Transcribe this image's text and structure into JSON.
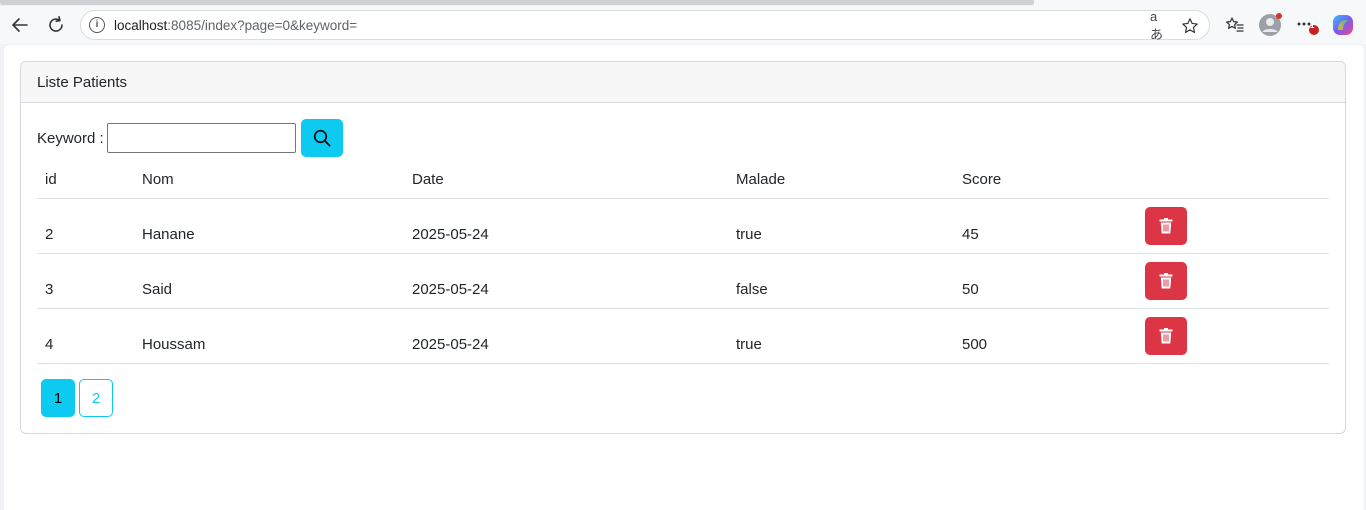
{
  "browser": {
    "url_host": "localhost",
    "url_path": ":8085/index?page=0&keyword=",
    "notification_count": "1"
  },
  "card": {
    "title": "Liste Patients"
  },
  "search": {
    "label": "Keyword :",
    "value": "",
    "placeholder": ""
  },
  "table": {
    "columns": [
      "id",
      "Nom",
      "Date",
      "Malade",
      "Score"
    ],
    "rows": [
      {
        "id": "2",
        "nom": "Hanane",
        "date": "2025-05-24",
        "malade": "true",
        "score": "45"
      },
      {
        "id": "3",
        "nom": "Said",
        "date": "2025-05-24",
        "malade": "false",
        "score": "50"
      },
      {
        "id": "4",
        "nom": "Houssam",
        "date": "2025-05-24",
        "malade": "true",
        "score": "500"
      }
    ]
  },
  "pagination": {
    "pages": [
      "1",
      "2"
    ],
    "active_page": "1"
  },
  "colors": {
    "info": "#0dcaf0",
    "danger": "#dc3545"
  },
  "icons": {
    "back": "arrow-left-icon",
    "reload": "reload-icon",
    "site_info": "info-icon",
    "translate": "translate-icon",
    "favorite": "star-icon",
    "favorites": "favorites-icon",
    "profile": "profile-icon",
    "more": "more-icon",
    "copilot": "copilot-icon",
    "search": "search-icon",
    "delete": "trash-icon"
  }
}
